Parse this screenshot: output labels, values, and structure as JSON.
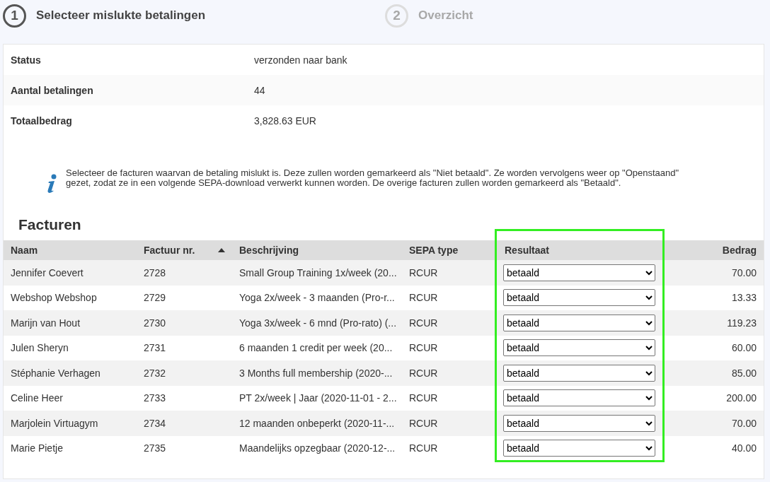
{
  "steps": [
    {
      "number": "1",
      "label": "Selecteer mislukte betalingen",
      "selected": true
    },
    {
      "number": "2",
      "label": "Overzicht",
      "selected": false
    }
  ],
  "summary": [
    {
      "label": "Status",
      "value": "verzonden naar bank"
    },
    {
      "label": "Aantal betalingen",
      "value": "44"
    },
    {
      "label": "Totaalbedrag",
      "value": "3,828.63 EUR"
    }
  ],
  "info": "Selecteer de facturen waarvan de betaling mislukt is. Deze zullen worden gemarkeerd als \"Niet betaald\". Ze worden vervolgens weer op \"Openstaand\" gezet, zodat ze in een volgende SEPA-download verwerkt kunnen worden. De overige facturen zullen worden gemarkeerd als \"Betaald\".",
  "table": {
    "title": "Facturen",
    "columns": [
      {
        "label": "Naam",
        "sorted": false
      },
      {
        "label": "Factuur nr.",
        "sorted": true
      },
      {
        "label": "Beschrijving",
        "sorted": false
      },
      {
        "label": "SEPA type",
        "sorted": false
      },
      {
        "label": "Resultaat",
        "sorted": false
      },
      {
        "label": "Bedrag",
        "sorted": false
      }
    ],
    "rows": [
      {
        "name": "Jennifer Coevert",
        "number": "2728",
        "description": "Small Group Training 1x/week (20...",
        "sepa": "RCUR",
        "result": "betaald",
        "amount": "70.00"
      },
      {
        "name": "Webshop Webshop",
        "number": "2729",
        "description": "Yoga 2x/week - 3 maanden (Pro-r...",
        "sepa": "RCUR",
        "result": "betaald",
        "amount": "13.33"
      },
      {
        "name": "Marijn van Hout",
        "number": "2730",
        "description": "Yoga 3x/week - 6 mnd (Pro-rato) (...",
        "sepa": "RCUR",
        "result": "betaald",
        "amount": "119.23"
      },
      {
        "name": "Julen Sheryn",
        "number": "2731",
        "description": "6 maanden 1 credit per week (20...",
        "sepa": "RCUR",
        "result": "betaald",
        "amount": "60.00"
      },
      {
        "name": "Stéphanie Verhagen",
        "number": "2732",
        "description": "3 Months full membership (2020-...",
        "sepa": "RCUR",
        "result": "betaald",
        "amount": "85.00"
      },
      {
        "name": "Celine Heer",
        "number": "2733",
        "description": "PT 2x/week | Jaar (2020-11-01 - 2...",
        "sepa": "RCUR",
        "result": "betaald",
        "amount": "200.00"
      },
      {
        "name": "Marjolein Virtuagym",
        "number": "2734",
        "description": "12 maanden onbeperkt (2020-11-...",
        "sepa": "RCUR",
        "result": "betaald",
        "amount": "70.00"
      },
      {
        "name": "Marie Pietje",
        "number": "2735",
        "description": "Maandelijks opzegbaar (2020-12-...",
        "sepa": "RCUR",
        "result": "betaald",
        "amount": "40.00"
      }
    ]
  }
}
